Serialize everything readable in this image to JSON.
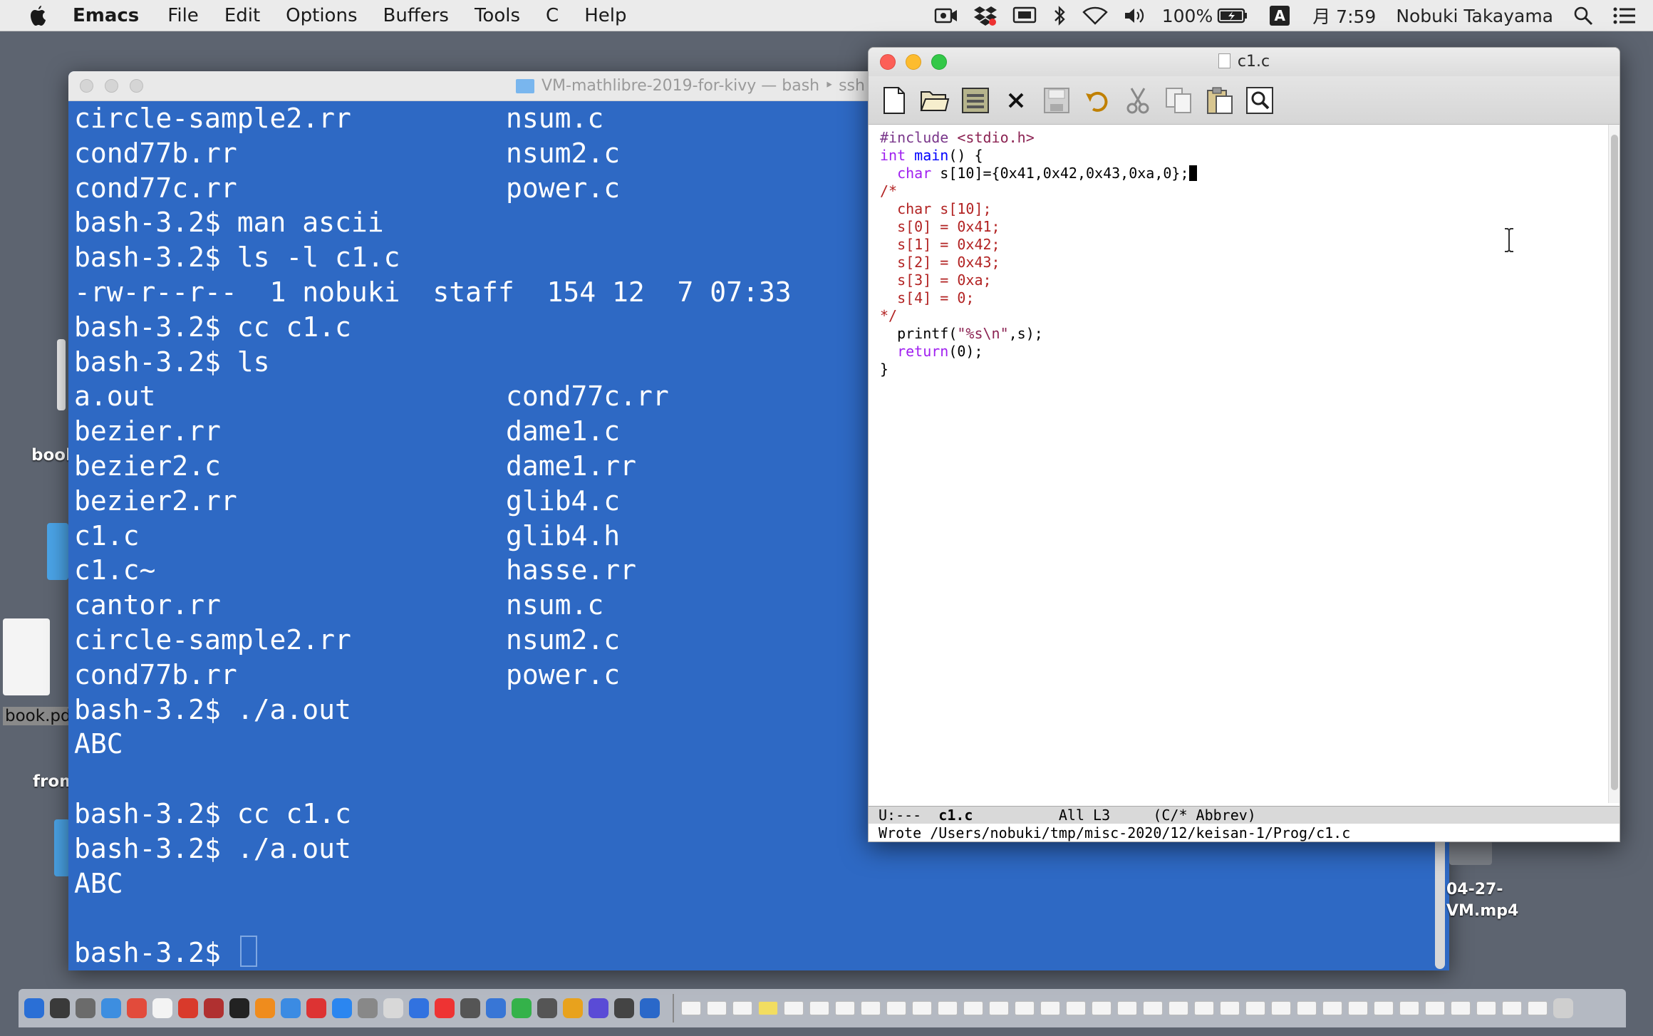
{
  "menubar": {
    "app_name": "Emacs",
    "menus": [
      "File",
      "Edit",
      "Options",
      "Buffers",
      "Tools",
      "C",
      "Help"
    ],
    "battery": "100%",
    "input_source": "A",
    "clock": "月 7:59",
    "user": "Nobuki Takayama"
  },
  "desktop": {
    "labels": [
      "book",
      "book.pd",
      "from"
    ],
    "video_name": [
      "04-27-",
      "VM.mp4"
    ]
  },
  "terminal": {
    "title": "VM-mathlibre-2019-for-kivy — bash ‣ ssh",
    "lines": [
      [
        "circle-sample2.rr",
        "nsum.c"
      ],
      [
        "cond77b.rr",
        "nsum2.c"
      ],
      [
        "cond77c.rr",
        "power.c"
      ],
      [
        "bash-3.2$ man ascii",
        ""
      ],
      [
        "bash-3.2$ ls -l c1.c",
        ""
      ],
      [
        "-rw-r--r--  1 nobuki  staff  154 12  7 07:33",
        ""
      ],
      [
        "bash-3.2$ cc c1.c",
        ""
      ],
      [
        "bash-3.2$ ls",
        ""
      ],
      [
        "a.out",
        "cond77c.rr"
      ],
      [
        "bezier.rr",
        "dame1.c"
      ],
      [
        "bezier2.c",
        "dame1.rr"
      ],
      [
        "bezier2.rr",
        "glib4.c"
      ],
      [
        "c1.c",
        "glib4.h"
      ],
      [
        "c1.c~",
        "hasse.rr"
      ],
      [
        "cantor.rr",
        "nsum.c"
      ],
      [
        "circle-sample2.rr",
        "nsum2.c"
      ],
      [
        "cond77b.rr",
        "power.c"
      ],
      [
        "bash-3.2$ ./a.out",
        ""
      ],
      [
        "ABC",
        ""
      ],
      [
        "",
        ""
      ],
      [
        "bash-3.2$ cc c1.c",
        ""
      ],
      [
        "bash-3.2$ ./a.out",
        ""
      ],
      [
        "ABC",
        ""
      ],
      [
        "",
        ""
      ]
    ],
    "prompt": "bash-3.2$ "
  },
  "emacs": {
    "title": "c1.c",
    "toolbar": [
      "new-file-icon",
      "open-folder-icon",
      "dired-icon",
      "close-icon",
      "save-icon",
      "undo-icon",
      "cut-icon",
      "copy-icon",
      "paste-icon",
      "search-icon"
    ],
    "code": {
      "l1_pp": "#include",
      "l1_hdr": " <stdio.h>",
      "l2_type": "int",
      "l2_fn": "main",
      "l2_rest": "() {",
      "l3_type": "char",
      "l3_rest": " s[10]={0x41,0x42,0x43,0xa,0};",
      "c_open": "/*",
      "c_lines": [
        "  char s[10];",
        "  s[0] = 0x41;",
        "  s[1] = 0x42;",
        "  s[2] = 0x43;",
        "  s[3] = 0xa;",
        "  s[4] = 0;"
      ],
      "c_close": "*/",
      "l_printf_a": "  printf(",
      "l_printf_str": "\"%s\\n\"",
      "l_printf_b": ",s);",
      "l_ret_kw": "return",
      "l_ret_rest": "(0);",
      "l_end": "}"
    },
    "modeline": {
      "status": "U:---  ",
      "buffer": "c1.c",
      "position": "          All L3     ",
      "mode": "(C/* Abbrev)"
    },
    "echo": "Wrote /Users/nobuki/tmp/misc-2020/12/keisan-1/Prog/c1.c"
  }
}
